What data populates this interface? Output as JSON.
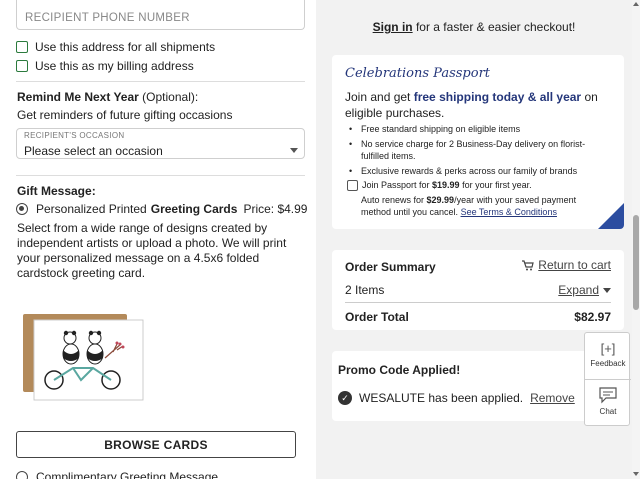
{
  "address": {
    "phone_placeholder": "RECIPIENT PHONE NUMBER",
    "use_all_shipments": "Use this address for all shipments",
    "use_billing": "Use this as my billing address"
  },
  "remind": {
    "title": "Remind Me Next Year",
    "optional": " (Optional):",
    "subtitle": "Get reminders of future gifting occasions",
    "occasion_label": "RECIPIENT'S OCCASION",
    "occasion_value": "Please select an occasion"
  },
  "gift": {
    "title": "Gift Message:",
    "printed_label_pre": "Personalized Printed",
    "printed_label_bold": "Greeting Cards",
    "printed_price": "Price: $4.99",
    "description": "Select from a wide range of designs created by independent artists or upload a photo. We will print your personalized message on a 4.5x6 folded cardstock greeting card.",
    "browse_label": "BROWSE CARDS",
    "complimentary_label": "Complimentary Greeting Message"
  },
  "checkout": {
    "signin_link": "Sign in",
    "signin_rest": " for a faster & easier checkout!"
  },
  "passport": {
    "logo": "Celebrations Passport",
    "intro_pre": "Join and get ",
    "intro_bold": "free shipping today & all year",
    "intro_post": " on eligible purchases.",
    "benefits": [
      "Free standard shipping on eligible items",
      "No service charge for 2 Business-Day delivery on florist-fulfilled items.",
      "Exclusive rewards & perks across our family of brands"
    ],
    "join_pre": "Join Passport for ",
    "join_price": "$19.99",
    "join_post": " for your first year.",
    "auto_pre": "Auto renews for ",
    "auto_price": "$29.99",
    "auto_post": "/year with your saved payment method until you cancel. ",
    "terms_link": "See Terms & Conditions"
  },
  "summary": {
    "title": "Order Summary",
    "return_link": "Return to cart",
    "items": "2 Items",
    "expand": "Expand",
    "total_label": "Order Total",
    "total_value": "$82.97"
  },
  "promo": {
    "title": "Promo Code Applied!",
    "code_text": "WESALUTE has been applied.",
    "remove": "Remove"
  },
  "widgets": {
    "feedback": "Feedback",
    "chat": "Chat"
  },
  "colors": {
    "accent_blue": "#24367a",
    "checkbox_green": "#2b7a3d"
  }
}
